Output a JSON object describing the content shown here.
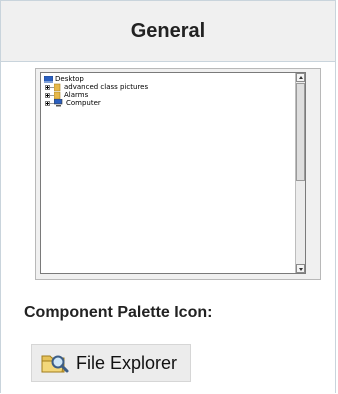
{
  "header": {
    "title": "General"
  },
  "tree": {
    "items": [
      {
        "label": "Desktop",
        "icon": "desktop-icon"
      },
      {
        "label": "advanced class pictures",
        "icon": "folder-icon"
      },
      {
        "label": "Alarms",
        "icon": "folder-icon"
      },
      {
        "label": "Computer",
        "icon": "computer-icon"
      }
    ]
  },
  "palette": {
    "label": "Component Palette Icon:",
    "button_label": "File Explorer",
    "icon": "magnifier-folder-icon"
  },
  "colors": {
    "header_bg": "#f0f0f0",
    "border": "#c9d4dc",
    "folder": "#e6b84a",
    "desktop": "#2b5fbf"
  }
}
